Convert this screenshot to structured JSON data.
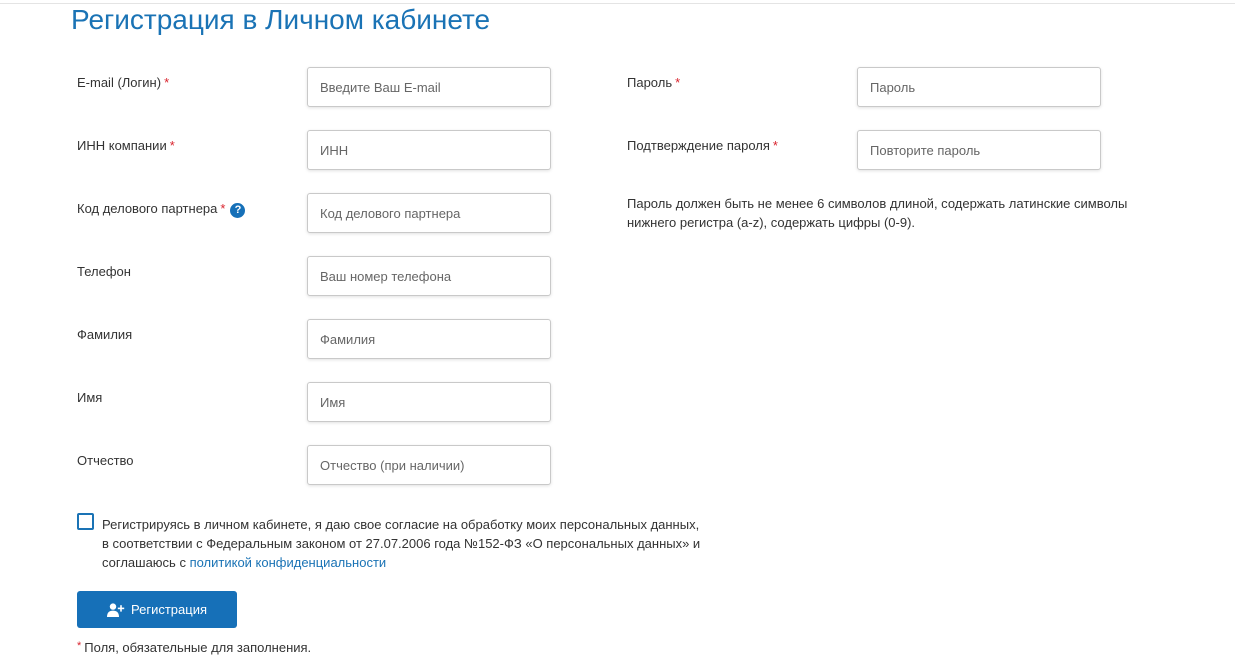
{
  "page": {
    "title": "Регистрация в Личном кабинете"
  },
  "form": {
    "required_mark": "*",
    "left_fields": [
      {
        "label": "E-mail (Логин)",
        "required": true,
        "placeholder": "Введите Ваш E-mail",
        "value": ""
      },
      {
        "label": "ИНН компании",
        "required": true,
        "placeholder": "ИНН",
        "value": ""
      },
      {
        "label": "Код делового партнера",
        "required": true,
        "placeholder": "Код делового партнера",
        "value": "",
        "help_icon": "question-circle-icon",
        "help_glyph": "?"
      },
      {
        "label": "Телефон",
        "required": false,
        "placeholder": "Ваш номер телефона",
        "value": ""
      },
      {
        "label": "Фамилия",
        "required": false,
        "placeholder": "Фамилия",
        "value": ""
      },
      {
        "label": "Имя",
        "required": false,
        "placeholder": "Имя",
        "value": ""
      },
      {
        "label": "Отчество",
        "required": false,
        "placeholder": "Отчество (при наличии)",
        "value": ""
      }
    ],
    "right_fields": [
      {
        "label": "Пароль",
        "required": true,
        "placeholder": "Пароль",
        "value": ""
      },
      {
        "label": "Подтверждение пароля",
        "required": true,
        "placeholder": "Повторите пароль",
        "value": ""
      }
    ],
    "password_hint": "Пароль должен быть не менее 6 символов длиной, содержать латинские символы нижнего регистра (a-z), содержать цифры (0-9).",
    "consent": {
      "checked": false,
      "text": "Регистрируясь в личном кабинете, я даю свое согласие на обработку моих персональных данных, в соответствии с Федеральным законом от 27.07.2006 года №152-ФЗ «О персональных данных» и соглашаюсь с ",
      "link_text": "политикой конфиденциальности"
    },
    "submit": {
      "label": "Регистрация",
      "icon": "user-plus-icon"
    },
    "required_note": "Поля, обязательные для заполнения."
  },
  "colors": {
    "accent": "#1a73b5",
    "button": "#1670b8",
    "required": "#d9232d"
  }
}
